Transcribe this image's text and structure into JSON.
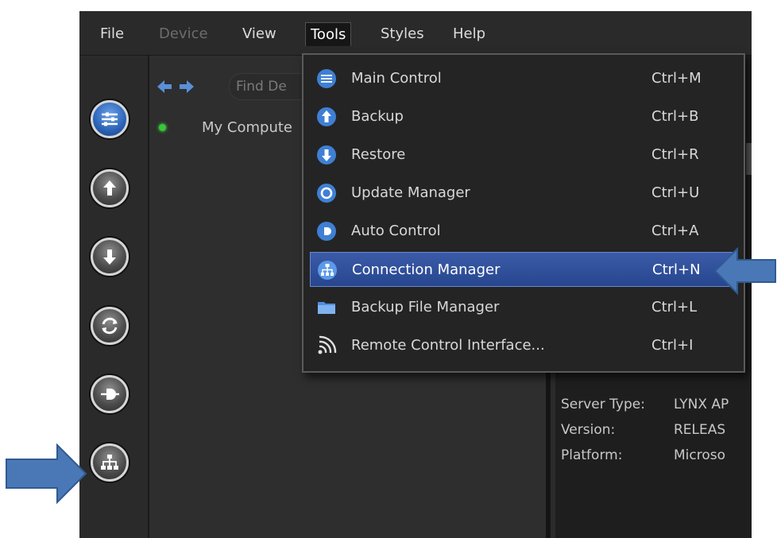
{
  "menubar": {
    "items": [
      {
        "label": "File",
        "state": "normal"
      },
      {
        "label": "Device",
        "state": "disabled"
      },
      {
        "label": "View",
        "state": "normal"
      },
      {
        "label": "Tools",
        "state": "open"
      },
      {
        "label": "Styles",
        "state": "normal"
      },
      {
        "label": "Help",
        "state": "normal"
      }
    ]
  },
  "left_rail": {
    "buttons": [
      {
        "icon": "main-control-icon",
        "selected": true
      },
      {
        "icon": "backup-icon",
        "selected": false
      },
      {
        "icon": "restore-icon",
        "selected": false
      },
      {
        "icon": "update-manager-icon",
        "selected": false
      },
      {
        "icon": "auto-control-icon",
        "selected": false
      },
      {
        "icon": "connection-manager-icon",
        "selected": false
      }
    ]
  },
  "tree": {
    "search_placeholder": "Find De",
    "item_label": "My Compute",
    "item_status_color": "#39c63c"
  },
  "info": {
    "rows": [
      {
        "key": "Server Type:",
        "value": "LYNX AP"
      },
      {
        "key": "Version:",
        "value": "RELEAS"
      },
      {
        "key": "Platform:",
        "value": "Microso"
      }
    ]
  },
  "tools_menu": {
    "items": [
      {
        "label": "Main Control",
        "shortcut": "Ctrl+M",
        "icon": "main-control-icon"
      },
      {
        "label": "Backup",
        "shortcut": "Ctrl+B",
        "icon": "backup-icon"
      },
      {
        "label": "Restore",
        "shortcut": "Ctrl+R",
        "icon": "restore-icon"
      },
      {
        "label": "Update Manager",
        "shortcut": "Ctrl+U",
        "icon": "update-manager-icon"
      },
      {
        "label": "Auto Control",
        "shortcut": "Ctrl+A",
        "icon": "auto-control-icon"
      },
      {
        "label": "Connection Manager",
        "shortcut": "Ctrl+N",
        "icon": "connection-manager-icon",
        "highlighted": true
      },
      {
        "label": "Backup File Manager",
        "shortcut": "Ctrl+L",
        "icon": "folder-icon"
      },
      {
        "label": "Remote Control Interface...",
        "shortcut": "Ctrl+I",
        "icon": "wireless-icon"
      }
    ]
  },
  "colors": {
    "highlight": "#2f4f9c",
    "callout_arrow": "#4a78b6",
    "app_background": "#2b2b2b"
  }
}
